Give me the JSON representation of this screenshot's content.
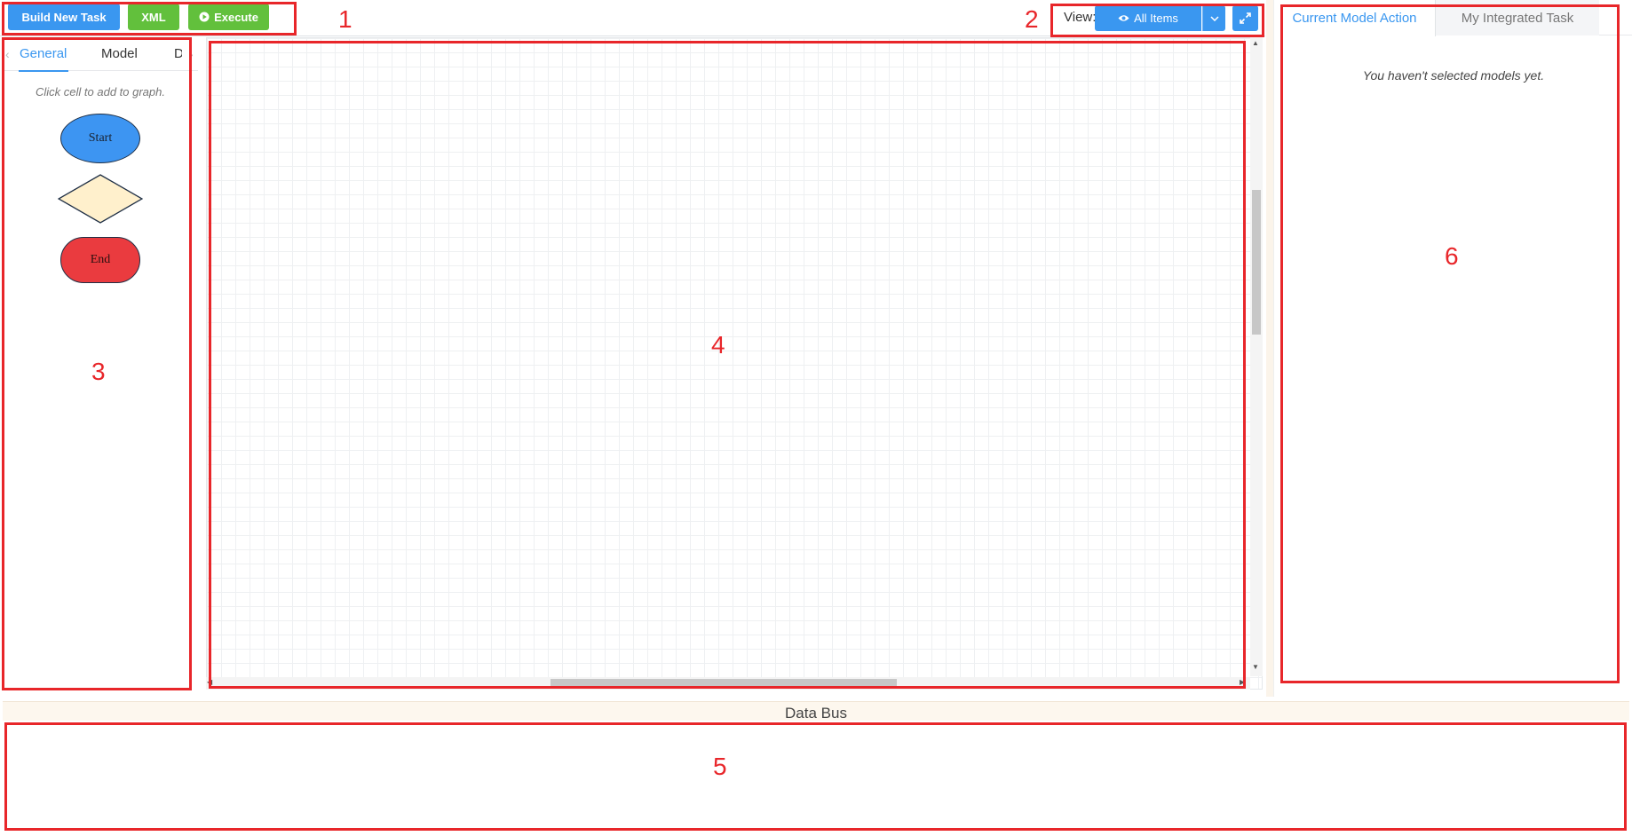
{
  "toolbar": {
    "build_label": "Build New Task",
    "xml_label": "XML",
    "execute_label": "Execute"
  },
  "view": {
    "label": "View:",
    "selected": "All Items"
  },
  "left_panel": {
    "tabs": [
      {
        "label": "General"
      },
      {
        "label": "Model"
      },
      {
        "label": "D"
      }
    ],
    "hint": "Click cell to add to graph.",
    "shapes": {
      "start_label": "Start",
      "end_label": "End"
    }
  },
  "right_panel": {
    "tabs": [
      {
        "label": "Current Model Action"
      },
      {
        "label": "My Integrated Task"
      }
    ],
    "empty_message": "You haven't selected models yet."
  },
  "data_bus": {
    "title": "Data Bus"
  },
  "annotations": {
    "markers": [
      "1",
      "2",
      "3",
      "4",
      "5",
      "6"
    ],
    "color": "#e8262a"
  },
  "colors": {
    "primary_blue": "#3a97f0",
    "success_green": "#62c03c",
    "start_fill": "#3d95f2",
    "decision_fill": "#fff0cc",
    "end_fill": "#ea3b3f"
  }
}
